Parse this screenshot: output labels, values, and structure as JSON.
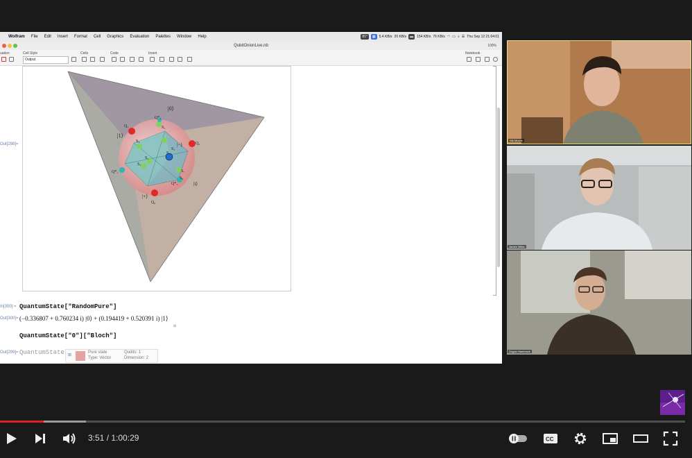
{
  "mac_menu": {
    "app_name": "Wolfram",
    "items": [
      "File",
      "Edit",
      "Insert",
      "Format",
      "Cell",
      "Graphics",
      "Evaluation",
      "Palettes",
      "Window",
      "Help"
    ],
    "status": {
      "temp": "81°",
      "net_up": "5.4 KB/s",
      "net_down": "20 KB/s",
      "disk_read": "154 KB/s",
      "disk_write": "76 KB/s",
      "clock": "Thu Sep 12  21:04:01"
    }
  },
  "notebook": {
    "title": "QubitOnionLive.nb",
    "zoom": "100%",
    "toolbar": {
      "cell_style_label": "Cell Style",
      "cell_style_value": "Output",
      "cells_label": "Cells",
      "code_label": "Code",
      "insert_label": "Insert",
      "notebook_label": "Notebook",
      "left_label": "uation"
    },
    "graphic_labels": {
      "ket0": "|0⟩",
      "ket1": "|1⟩",
      "ketminus": "|−⟩",
      "ketplus": "|+⟩",
      "keti": "|i⟩",
      "ketmi": "|−i⟩",
      "q1": "Q₁",
      "q2": "Q₂",
      "q3": "Q₃",
      "q1s": "Q*₁",
      "q2s": "Q*₂",
      "q3s": "Q*₃",
      "s1": "S₁",
      "s2": "S₂",
      "s3": "S₃",
      "s4": "S₄",
      "s5": "S₅",
      "s6": "S₆",
      "s7": "S₇",
      "s8": "S₈"
    },
    "cells": {
      "out298_label": "Out[298]=",
      "in300_label": "In[300]:=",
      "in300_code": "QuantumState[\"RandomPure\"]",
      "out300_label": "Out[300]=",
      "out300_math": "(−0.336807 + 0.760234 i) |0⟩ + (0.194419 + 0.520391 i) |1⟩",
      "in_code_2": "QuantumState[\"0\"][\"Bloch\"]",
      "out299_label": "Out[299]=",
      "out299_head": "QuantumState",
      "summary": {
        "state_label": "Pure state",
        "type_label": "Type: Vector",
        "qudits_label": "Qudits: 1",
        "dimension_label": "Dimension: 2"
      }
    }
  },
  "participants": [
    {
      "name": "Nik Murzin"
    },
    {
      "name": "James Wiles"
    },
    {
      "name": "Dugan Hammock"
    }
  ],
  "player": {
    "current_time": "3:51",
    "separator": " / ",
    "duration": "1:00:29",
    "played_fraction": 0.064,
    "buffered_fraction": 0.125,
    "accent": "#e01f1f"
  }
}
